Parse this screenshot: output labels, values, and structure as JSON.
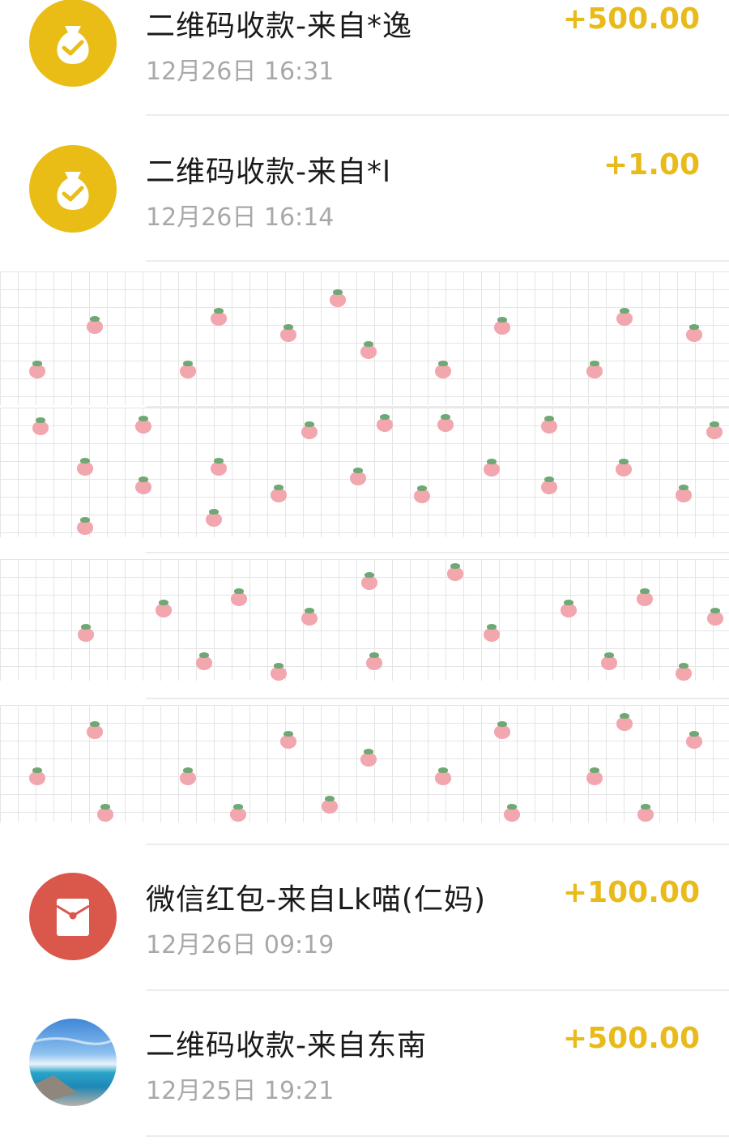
{
  "transactions": [
    {
      "title": "二维码收款-来自*逸",
      "time": "12月26日 16:31",
      "amount": "+500.00",
      "icon": "money-bag-check-icon",
      "icon_color": "#e9bd16"
    },
    {
      "title": "二维码收款-来自*l",
      "time": "12月26日 16:14",
      "amount": "+1.00",
      "icon": "money-bag-check-icon",
      "icon_color": "#e9bd16"
    },
    {
      "title": "微信红包-来自Lk喵(仁妈)",
      "time": "12月26日 09:19",
      "amount": "+100.00",
      "icon": "red-packet-icon",
      "icon_color": "#d9574b"
    },
    {
      "title": "二维码收款-来自东南",
      "time": "12月25日 19:21",
      "amount": "+500.00",
      "icon": "seaside-photo-avatar",
      "icon_color": ""
    }
  ],
  "amount_color": "#e8bb1a",
  "redaction": "strawberry-grid-sticker"
}
